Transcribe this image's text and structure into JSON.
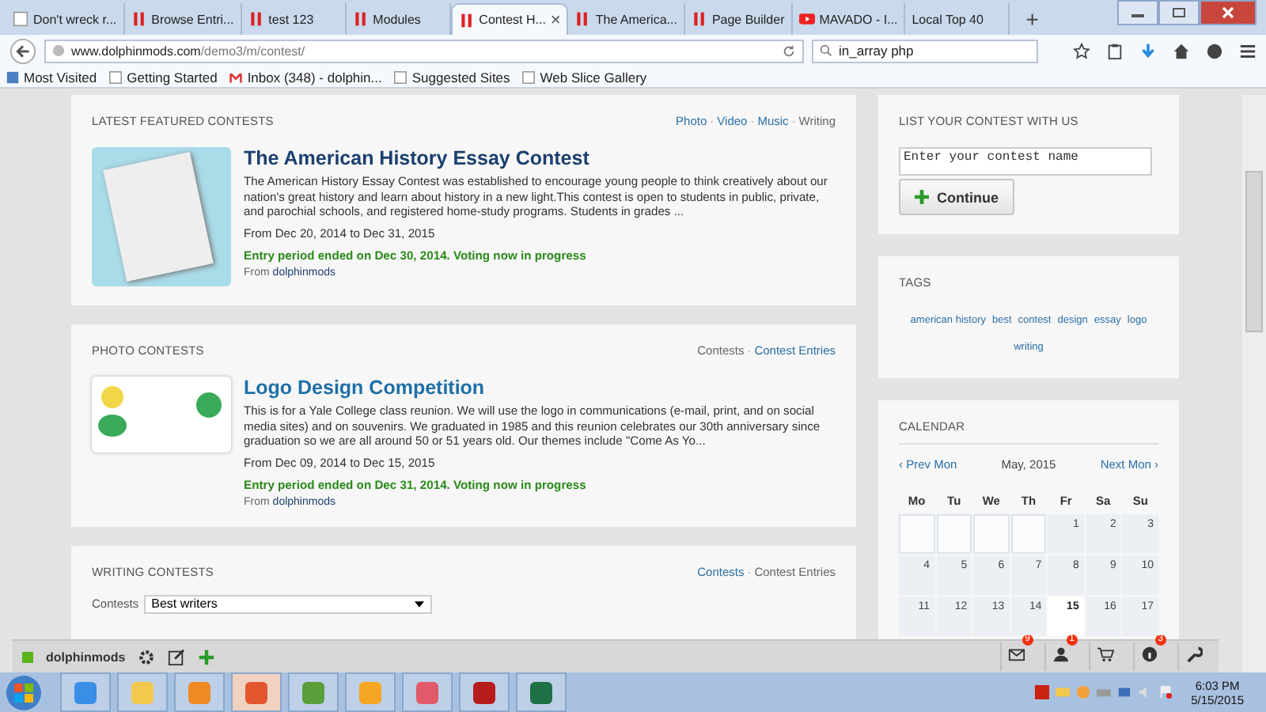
{
  "browser": {
    "tabs": [
      {
        "title": "Don't wreck r...",
        "kind": "page",
        "selected": false
      },
      {
        "title": "Browse Entri...",
        "kind": "bars",
        "selected": false
      },
      {
        "title": "test 123",
        "kind": "bars",
        "selected": false
      },
      {
        "title": "Modules",
        "kind": "bars",
        "selected": false
      },
      {
        "title": "Contest H...",
        "kind": "bars",
        "selected": true
      },
      {
        "title": "The America...",
        "kind": "bars",
        "selected": false
      },
      {
        "title": "Page Builder",
        "kind": "bars",
        "selected": false
      },
      {
        "title": "MAVADO - I...",
        "kind": "video",
        "selected": false
      },
      {
        "title": "Local Top 40",
        "kind": "plain",
        "selected": false
      }
    ],
    "close_tab": "×",
    "new_tab": "+",
    "url": {
      "host": "www.dolphinmods.com",
      "path": "/demo3/m/contest/"
    },
    "search": "in_array php",
    "bookmarks": [
      {
        "label": "Most Visited",
        "kind": "folder"
      },
      {
        "label": "Getting Started",
        "kind": "page"
      },
      {
        "label": "Inbox (348) - dolphin...",
        "kind": "mail"
      },
      {
        "label": "Suggested Sites",
        "kind": "page"
      },
      {
        "label": "Web Slice Gallery",
        "kind": "page"
      }
    ]
  },
  "link_separator": "·",
  "sections": [
    {
      "title": "LATEST FEATURED CONTESTS",
      "links": [
        {
          "label": "Photo",
          "selected": false
        },
        {
          "label": "Video",
          "selected": false
        },
        {
          "label": "Music",
          "selected": false
        },
        {
          "label": "Writing",
          "selected": true
        }
      ],
      "entries": [
        {
          "kind": "essay",
          "title": "The American History Essay Contest",
          "description": "The American History Essay Contest was established to encourage young people to think creatively about our nation's great history and learn about history in a new light.This contest is open to students in public, private, and parochial schools, and registered home-study programs. Students in grades ...",
          "dates": "From Dec 20, 2014 to Dec 31, 2015",
          "status": "Entry period ended on Dec 30, 2014. Voting now in progress",
          "from": "From",
          "author": "dolphinmods"
        }
      ]
    },
    {
      "title": "PHOTO CONTESTS",
      "links": [
        {
          "label": "Contests",
          "selected": true
        },
        {
          "label": "Contest Entries",
          "selected": false
        }
      ],
      "entries": [
        {
          "kind": "logo",
          "title": "Logo Design Competition",
          "description": "This is for a Yale College class reunion. We will use the logo in communications (e-mail, print, and on social media sites) and on souvenirs. We graduated in 1985 and this reunion celebrates our 30th anniversary since graduation so we are all around 50 or 51 years old. Our themes include \"Come As Yo...",
          "dates": "From Dec 09, 2014 to Dec 15, 2015",
          "status": "Entry period ended on Dec 31, 2014. Voting now in progress",
          "from": "From",
          "author": "dolphinmods"
        }
      ]
    },
    {
      "title": "WRITING CONTESTS",
      "links": [
        {
          "label": "Contests",
          "selected": false
        },
        {
          "label": "Contest Entries",
          "selected": true
        }
      ],
      "filter": {
        "label": "Contests",
        "value": "Best writers"
      }
    }
  ],
  "sidebar": {
    "list_contest": {
      "title": "LIST YOUR CONTEST WITH US",
      "placeholder": "Enter your contest name",
      "button": "Continue"
    },
    "tags": {
      "title": "TAGS",
      "items": [
        "american history",
        "best",
        "contest",
        "design",
        "essay",
        "logo",
        "writing"
      ]
    },
    "calendar": {
      "title": "CALENDAR",
      "prev": "‹ Prev Mon",
      "month": "May, 2015",
      "next": "Next Mon ›",
      "weekdays": [
        "Mo",
        "Tu",
        "We",
        "Th",
        "Fr",
        "Sa",
        "Su"
      ],
      "weeks": [
        [
          {
            "kind": "blank"
          },
          {
            "kind": "blank"
          },
          {
            "kind": "blank"
          },
          {
            "kind": "blank"
          },
          {
            "kind": "day",
            "day": "1",
            "today": false
          },
          {
            "kind": "day",
            "day": "2",
            "today": false
          },
          {
            "kind": "day",
            "day": "3",
            "today": false
          }
        ],
        [
          {
            "kind": "day",
            "day": "4",
            "today": false
          },
          {
            "kind": "day",
            "day": "5",
            "today": false
          },
          {
            "kind": "day",
            "day": "6",
            "today": false
          },
          {
            "kind": "day",
            "day": "7",
            "today": false
          },
          {
            "kind": "day",
            "day": "8",
            "today": false
          },
          {
            "kind": "day",
            "day": "9",
            "today": false
          },
          {
            "kind": "day",
            "day": "10",
            "today": false
          }
        ],
        [
          {
            "kind": "day",
            "day": "11",
            "today": false
          },
          {
            "kind": "day",
            "day": "12",
            "today": false
          },
          {
            "kind": "day",
            "day": "13",
            "today": false
          },
          {
            "kind": "day",
            "day": "14",
            "today": false
          },
          {
            "kind": "day",
            "day": "15",
            "today": true
          },
          {
            "kind": "day",
            "day": "16",
            "today": false
          },
          {
            "kind": "day",
            "day": "17",
            "today": false
          }
        ]
      ]
    }
  },
  "admin_bar": {
    "user": "dolphinmods",
    "tools": [
      {
        "kind": "mail",
        "count": "9"
      },
      {
        "kind": "person",
        "count": "1"
      },
      {
        "kind": "cart"
      },
      {
        "kind": "info",
        "count": "3"
      },
      {
        "kind": "wrench"
      }
    ]
  },
  "taskbar": {
    "apps": [
      {
        "kind": "ie",
        "selected": false
      },
      {
        "kind": "folder",
        "selected": false
      },
      {
        "kind": "media",
        "selected": false
      },
      {
        "kind": "firefox",
        "selected": true
      },
      {
        "kind": "frog",
        "selected": false
      },
      {
        "kind": "notes",
        "selected": false
      },
      {
        "kind": "eraser",
        "selected": false
      },
      {
        "kind": "ftp",
        "selected": false
      },
      {
        "kind": "excel",
        "selected": false
      }
    ],
    "time": "6:03 PM",
    "date": "5/15/2015"
  }
}
